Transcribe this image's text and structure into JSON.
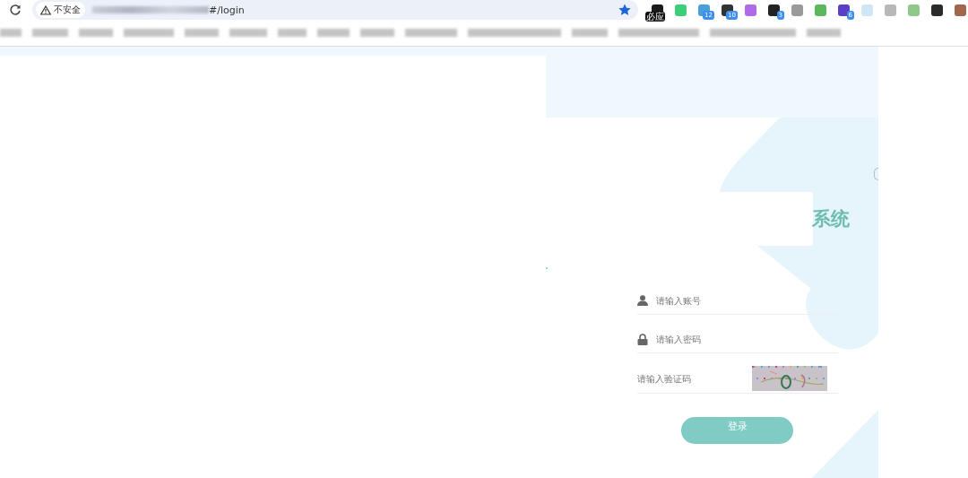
{
  "browser": {
    "security_label": "不安全",
    "url_visible": "#/login",
    "bookmarked": true,
    "extensions": [
      {
        "color": "#1a1a1a",
        "label": "必应"
      },
      {
        "color": "#3ccf7a"
      },
      {
        "color": "#4a9fd8",
        "badge": "12"
      },
      {
        "color": "#333333",
        "badge": "10"
      },
      {
        "color": "#b06ae8"
      },
      {
        "color": "#222222",
        "badge": "3"
      },
      {
        "color": "#9a9a9a"
      },
      {
        "color": "#5cb85c"
      },
      {
        "color": "#5b3fc4",
        "badge": "6"
      },
      {
        "color": "#cfe6f7"
      },
      {
        "color": "#b8b8b8"
      },
      {
        "color": "#8cc98a"
      },
      {
        "color": "#2a2a2a"
      },
      {
        "color": "#a0674a"
      }
    ]
  },
  "login": {
    "title_visible": "系统",
    "fields": [
      {
        "kind": "account",
        "placeholder": "请输入账号"
      },
      {
        "kind": "password",
        "placeholder": "请输入密码"
      },
      {
        "kind": "captcha",
        "placeholder": "请输入验证码"
      }
    ],
    "submit": "登录"
  }
}
